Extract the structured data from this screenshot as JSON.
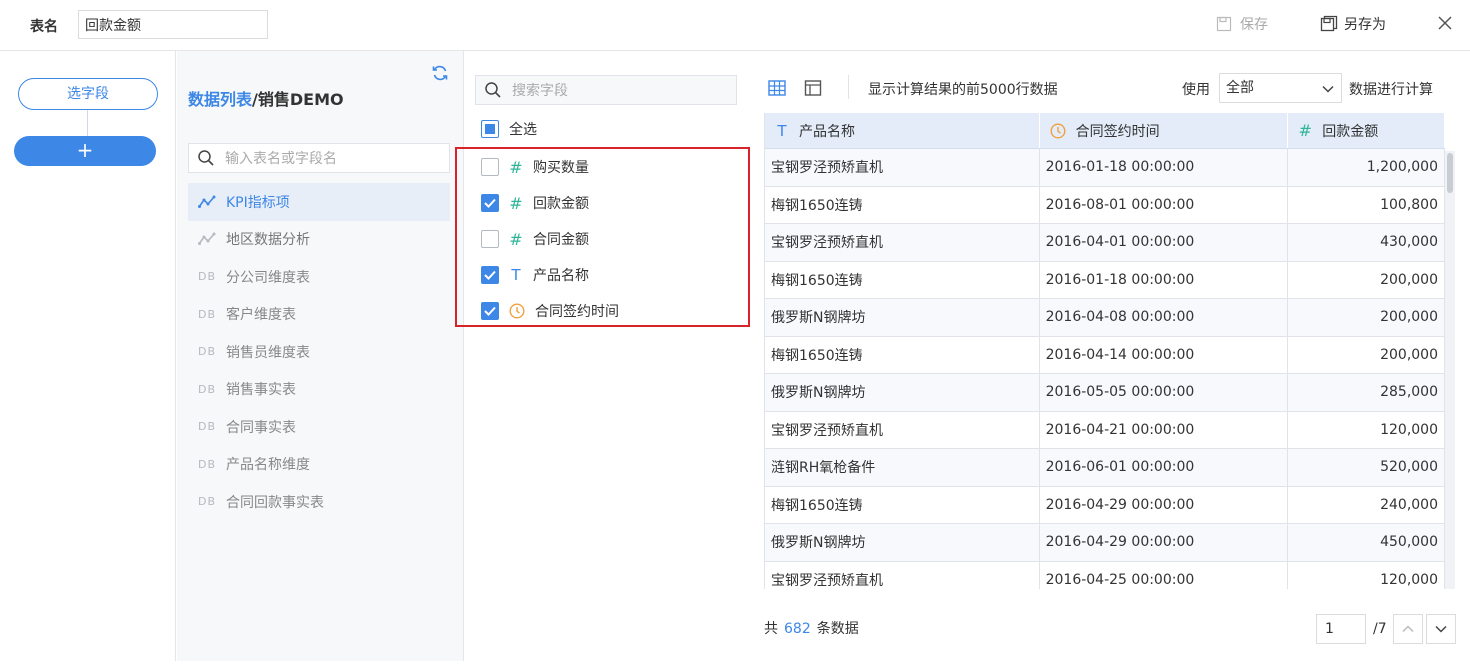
{
  "topbar": {
    "table_name_label": "表名",
    "table_name_value": "回款金额",
    "save_label": "保存",
    "save_as_label": "另存为"
  },
  "left": {
    "select_field_label": "选字段",
    "add_label": "+"
  },
  "table_panel": {
    "title_prefix": "数据列表",
    "title_suffix": "/销售DEMO",
    "search_placeholder": "输入表名或字段名",
    "items": [
      {
        "label": "KPI指标项",
        "icon": "analysis-icon",
        "active": true
      },
      {
        "label": "地区数据分析",
        "icon": "analysis-icon"
      },
      {
        "label": "分公司维度表",
        "icon": "db-icon"
      },
      {
        "label": "客户维度表",
        "icon": "db-icon"
      },
      {
        "label": "销售员维度表",
        "icon": "db-icon"
      },
      {
        "label": "销售事实表",
        "icon": "db-icon"
      },
      {
        "label": "合同事实表",
        "icon": "db-icon"
      },
      {
        "label": "产品名称维度",
        "icon": "db-icon"
      },
      {
        "label": "合同回款事实表",
        "icon": "db-icon"
      }
    ]
  },
  "field_panel": {
    "search_placeholder": "搜索字段",
    "select_all_label": "全选",
    "fields": [
      {
        "label": "购买数量",
        "type": "number",
        "checked": false
      },
      {
        "label": "回款金额",
        "type": "number",
        "checked": true
      },
      {
        "label": "合同金额",
        "type": "number",
        "checked": false
      },
      {
        "label": "产品名称",
        "type": "text",
        "checked": true
      },
      {
        "label": "合同签约时间",
        "type": "date",
        "checked": true
      }
    ]
  },
  "preview": {
    "info_text": "显示计算结果的前5000行数据",
    "use_label": "使用",
    "scope_value": "全部",
    "calc_label": "数据进行计算",
    "columns": [
      {
        "label": "产品名称",
        "type": "text"
      },
      {
        "label": "合同签约时间",
        "type": "date"
      },
      {
        "label": "回款金额",
        "type": "number"
      }
    ],
    "rows": [
      [
        "宝钢罗泾预矫直机",
        "2016-01-18 00:00:00",
        "1,200,000"
      ],
      [
        "梅钢1650连铸",
        "2016-08-01 00:00:00",
        "100,800"
      ],
      [
        "宝钢罗泾预矫直机",
        "2016-04-01 00:00:00",
        "430,000"
      ],
      [
        "梅钢1650连铸",
        "2016-01-18 00:00:00",
        "200,000"
      ],
      [
        "俄罗斯N钢牌坊",
        "2016-04-08 00:00:00",
        "200,000"
      ],
      [
        "梅钢1650连铸",
        "2016-04-14 00:00:00",
        "200,000"
      ],
      [
        "俄罗斯N钢牌坊",
        "2016-05-05 00:00:00",
        "285,000"
      ],
      [
        "宝钢罗泾预矫直机",
        "2016-04-21 00:00:00",
        "120,000"
      ],
      [
        "涟钢RH氧枪备件",
        "2016-06-01 00:00:00",
        "520,000"
      ],
      [
        "梅钢1650连铸",
        "2016-04-29 00:00:00",
        "240,000"
      ],
      [
        "俄罗斯N钢牌坊",
        "2016-04-29 00:00:00",
        "450,000"
      ],
      [
        "宝钢罗泾预矫直机",
        "2016-04-25 00:00:00",
        "120,000"
      ]
    ],
    "footer_prefix": "共",
    "total_count": "682",
    "footer_suffix": "条数据",
    "page_value": "1",
    "page_total": "/7"
  },
  "colors": {
    "accent": "#3d87e6",
    "number_type": "#2fb59a",
    "date_type": "#f0a040",
    "highlight_box": "#d9232b"
  }
}
